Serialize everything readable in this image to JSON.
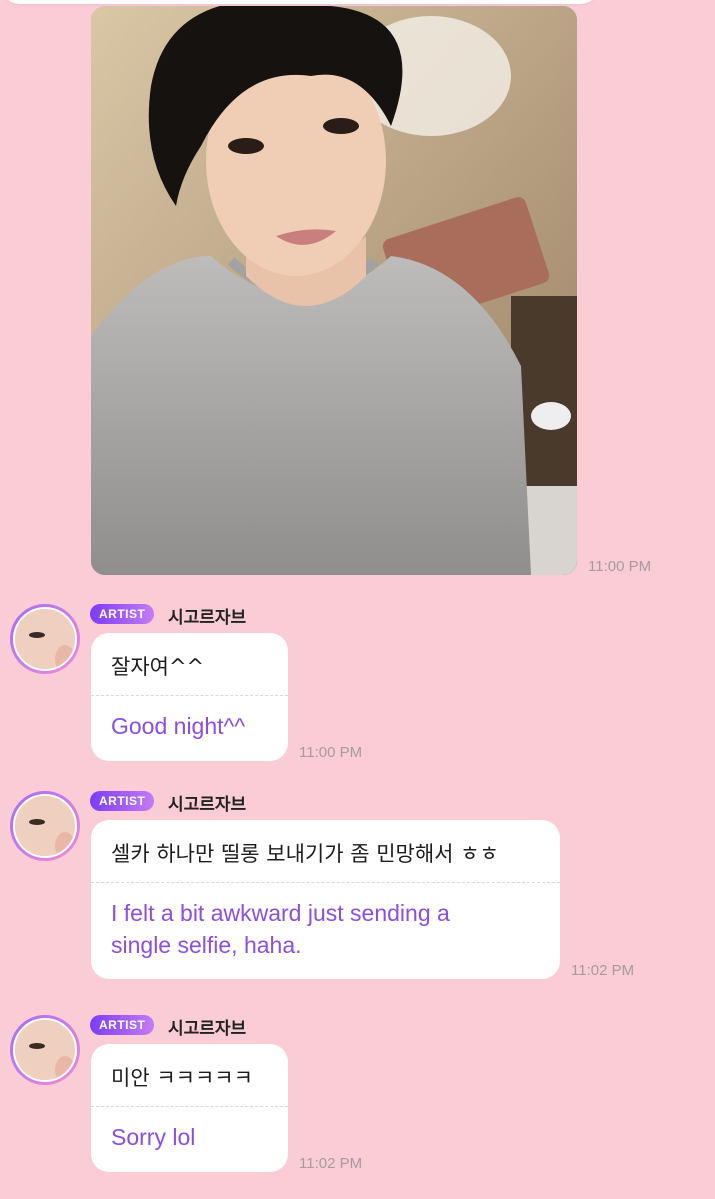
{
  "photo_message": {
    "time": "11:00 PM"
  },
  "messages": [
    {
      "badge": "ARTIST",
      "sender": "시고르자브",
      "original": "잘자여^^",
      "translation": "Good night^^",
      "time": "11:00 PM"
    },
    {
      "badge": "ARTIST",
      "sender": "시고르자브",
      "original": "셀카 하나만 띨롱 보내기가 좀 민망해서 ㅎㅎ",
      "translation": "I felt a bit awkward just sending a single selfie, haha.",
      "time": "11:02 PM"
    },
    {
      "badge": "ARTIST",
      "sender": "시고르자브",
      "original": "미안 ㅋㅋㅋㅋㅋ",
      "translation": "Sorry lol",
      "time": "11:02 PM"
    }
  ]
}
